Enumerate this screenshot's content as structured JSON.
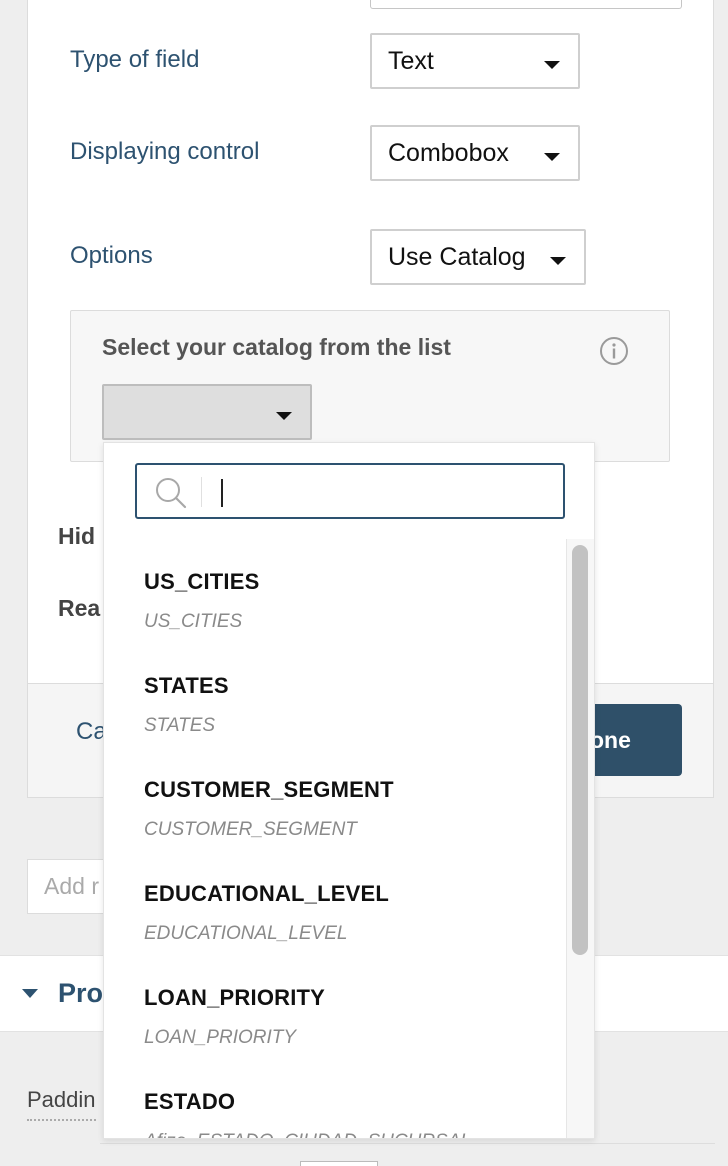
{
  "form": {
    "type_of_field_label": "Type of field",
    "type_of_field_value": "Text",
    "displaying_control_label": "Displaying control",
    "displaying_control_value": "Combobox",
    "options_label": "Options",
    "options_value": "Use Catalog",
    "catalog_title": "Select your catalog from the list",
    "catalog_selected": "",
    "hidden_label_partial": "Hid",
    "readonly_label_partial": "Rea"
  },
  "footer": {
    "cancel_partial": "Ca",
    "done_partial": "one"
  },
  "add_input_placeholder_partial": "Add r",
  "section": {
    "title_partial": "Pro"
  },
  "padding_label_partial": "Paddin",
  "dropdown": {
    "search_value": "",
    "items": [
      {
        "title": "US_CITIES",
        "subtitle": "US_CITIES"
      },
      {
        "title": "STATES",
        "subtitle": "STATES"
      },
      {
        "title": "CUSTOMER_SEGMENT",
        "subtitle": "CUSTOMER_SEGMENT"
      },
      {
        "title": "EDUCATIONAL_LEVEL",
        "subtitle": "EDUCATIONAL_LEVEL"
      },
      {
        "title": "LOAN_PRIORITY",
        "subtitle": "LOAN_PRIORITY"
      },
      {
        "title": "ESTADO",
        "subtitle": "Afiza_ESTADO_CIUDAD_SUCURSAL"
      }
    ]
  },
  "colors": {
    "label_blue": "#2d5270",
    "done_button": "#2f5069",
    "page_bg": "#eeeeee"
  },
  "icons": [
    "chevron-down-icon",
    "info-icon",
    "search-icon",
    "section-collapse-icon"
  ]
}
